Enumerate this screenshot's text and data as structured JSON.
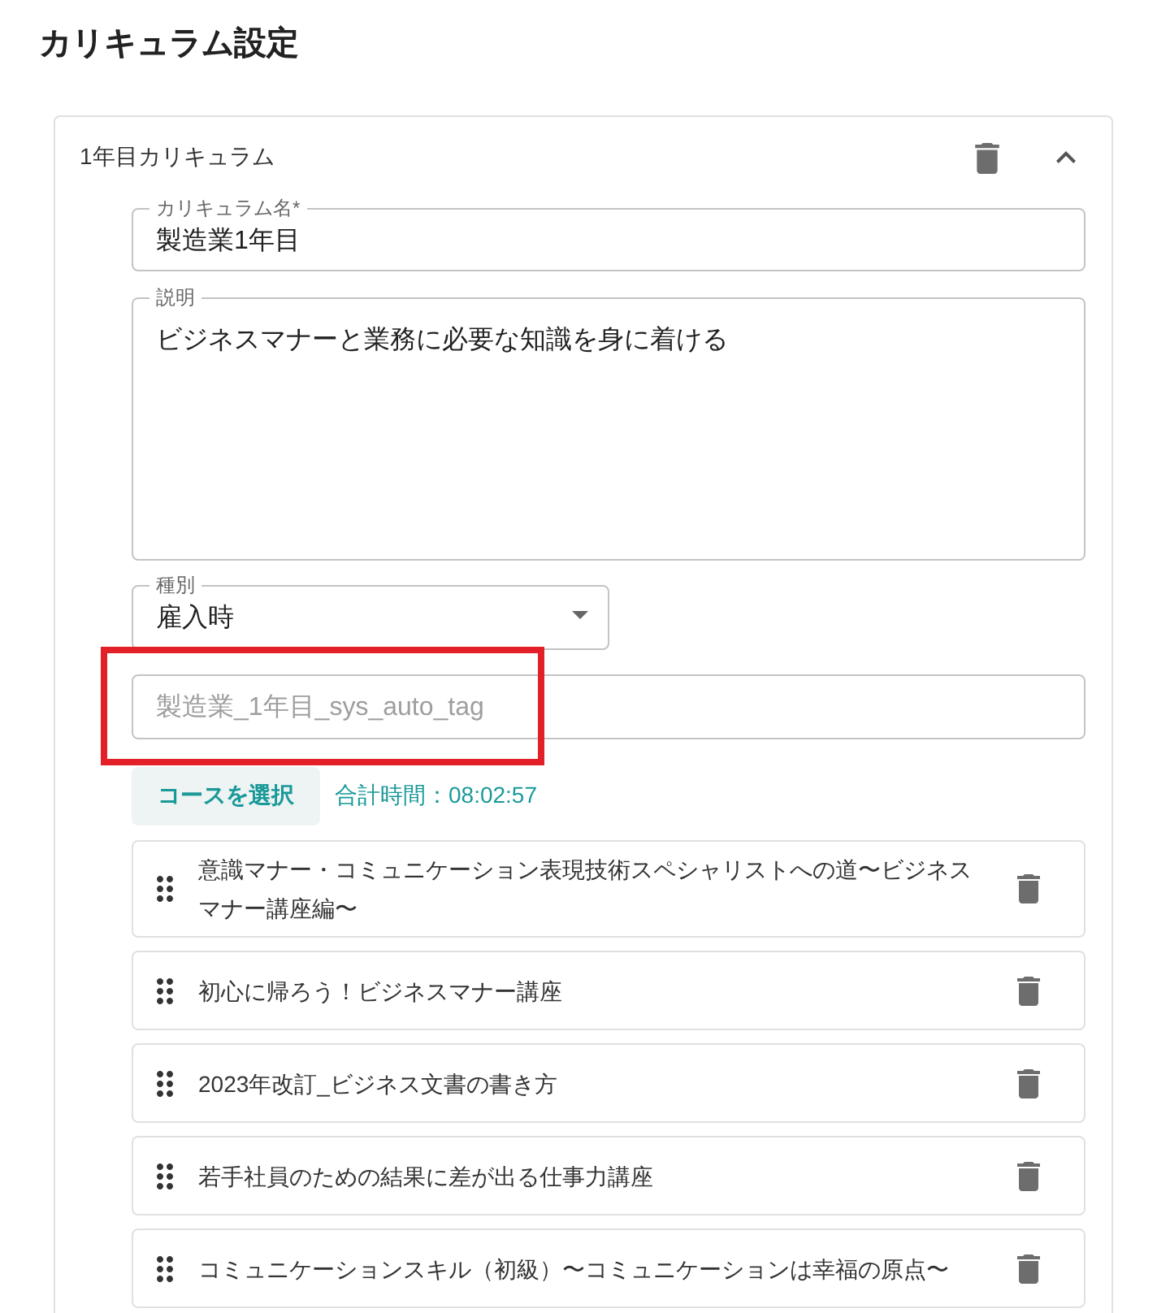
{
  "title": "カリキュラム設定",
  "curriculum": {
    "heading": "1年目カリキュラム",
    "expanded": true,
    "name_field": {
      "label": "カリキュラム名*",
      "value": "製造業1年目"
    },
    "description_field": {
      "label": "説明",
      "value": "ビジネスマナーと業務に必要な知識を身に着ける"
    },
    "type_select": {
      "label": "種別",
      "value": "雇入時"
    },
    "tag_field": {
      "placeholder": "製造業_1年目_sys_auto_tag",
      "highlighted": true
    },
    "select_courses_button": "コースを選択",
    "total_time": "合計時間：08:02:57",
    "courses": [
      {
        "title": "意識マナー・コミュニケーション表現技術スペシャリストへの道〜ビジネスマナー講座編〜"
      },
      {
        "title": "初心に帰ろう！ビジネスマナー講座"
      },
      {
        "title": "2023年改訂_ビジネス文書の書き方"
      },
      {
        "title": "若手社員のための結果に差が出る仕事力講座"
      },
      {
        "title": "コミュニケーションスキル（初級）〜コミュニケーションは幸福の原点〜"
      }
    ]
  }
}
